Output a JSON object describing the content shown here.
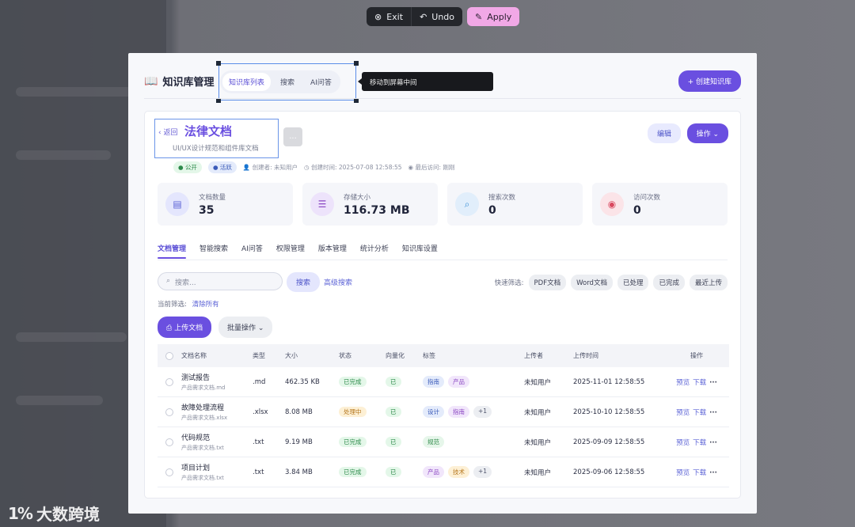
{
  "toolbar": {
    "exit_label": "Exit",
    "undo_label": "Undo",
    "apply_label": "Apply"
  },
  "header": {
    "title": "知识库管理",
    "tabs": [
      "知识库列表",
      "搜索",
      "AI问答"
    ],
    "tooltip": "移动到屏幕中间",
    "create_label": "+ 创建知识库"
  },
  "doc": {
    "back_label": "返回",
    "title": "法律文档",
    "subtitle": "UI/UX设计规范和组件库文档",
    "more_label": "...",
    "edit_label": "编辑",
    "op_label": "操作",
    "badge_public": "公开",
    "badge_active": "活跃",
    "creator": "创建者: 未知用户",
    "created_time": "创建时间: 2025-07-08 12:58:55",
    "last_visit": "最后访问: 刚刚"
  },
  "stats": [
    {
      "label": "文档数量",
      "value": "35",
      "icon": "document-icon",
      "color": "#5b62d6",
      "bg": "#e4e6fd"
    },
    {
      "label": "存储大小",
      "value": "116.73 MB",
      "icon": "database-icon",
      "color": "#8a45c2",
      "bg": "#ede3fb"
    },
    {
      "label": "搜索次数",
      "value": "0",
      "icon": "search-icon",
      "color": "#3a8fd6",
      "bg": "#e1eefb"
    },
    {
      "label": "访问次数",
      "value": "0",
      "icon": "eye-icon",
      "color": "#d9485f",
      "bg": "#fbe4e8"
    }
  ],
  "tabs": [
    "文档管理",
    "智能搜索",
    "AI问答",
    "权限管理",
    "版本管理",
    "统计分析",
    "知识库设置"
  ],
  "search": {
    "placeholder": "搜索...",
    "button_label": "搜索",
    "advanced_label": "高级搜索",
    "quick_label": "快速筛选:",
    "quick_chips": [
      "PDF文档",
      "Word文档",
      "已处理",
      "已完成",
      "最近上传"
    ],
    "current_filter": "当前筛选:",
    "clear_label": "清除所有"
  },
  "actions": {
    "upload_label": "上传文档",
    "bulk_label": "批量操作"
  },
  "table": {
    "headers": [
      "文档名称",
      "类型",
      "大小",
      "状态",
      "向量化",
      "标签",
      "上传者",
      "上传时间",
      "操作"
    ],
    "rows": [
      {
        "name": "测试报告",
        "sub": "产品需求文档.md",
        "type": ".md",
        "size": "462.35 KB",
        "status": "已完成",
        "status_kind": "done",
        "vec": "已",
        "tags": [
          [
            "指南",
            "blue"
          ],
          [
            "产品",
            "pur"
          ]
        ],
        "uploader": "未知用户",
        "time": "2025-11-01 12:58:55"
      },
      {
        "name": "故障处理流程",
        "sub": "产品需求文档.xlsx",
        "type": ".xlsx",
        "size": "8.08 MB",
        "status": "处理中",
        "status_kind": "proc",
        "vec": "已",
        "tags": [
          [
            "设计",
            "blue"
          ],
          [
            "指南",
            "pur"
          ],
          [
            "+1",
            "gray"
          ]
        ],
        "uploader": "未知用户",
        "time": "2025-10-10 12:58:55"
      },
      {
        "name": "代码规范",
        "sub": "产品需求文档.txt",
        "type": ".txt",
        "size": "9.19 MB",
        "status": "已完成",
        "status_kind": "done",
        "vec": "已",
        "tags": [
          [
            "规范",
            "green"
          ]
        ],
        "uploader": "未知用户",
        "time": "2025-09-09 12:58:55"
      },
      {
        "name": "项目计划",
        "sub": "产品需求文档.txt",
        "type": ".txt",
        "size": "3.84 MB",
        "status": "已完成",
        "status_kind": "done",
        "vec": "已",
        "tags": [
          [
            "产品",
            "pur"
          ],
          [
            "技术",
            "org"
          ],
          [
            "+1",
            "gray"
          ]
        ],
        "uploader": "未知用户",
        "time": "2025-09-06 12:58:55"
      }
    ],
    "action_preview": "预览",
    "action_download": "下载",
    "action_more": "···"
  },
  "watermark": {
    "logo": "1%",
    "text": "大数跨境"
  }
}
